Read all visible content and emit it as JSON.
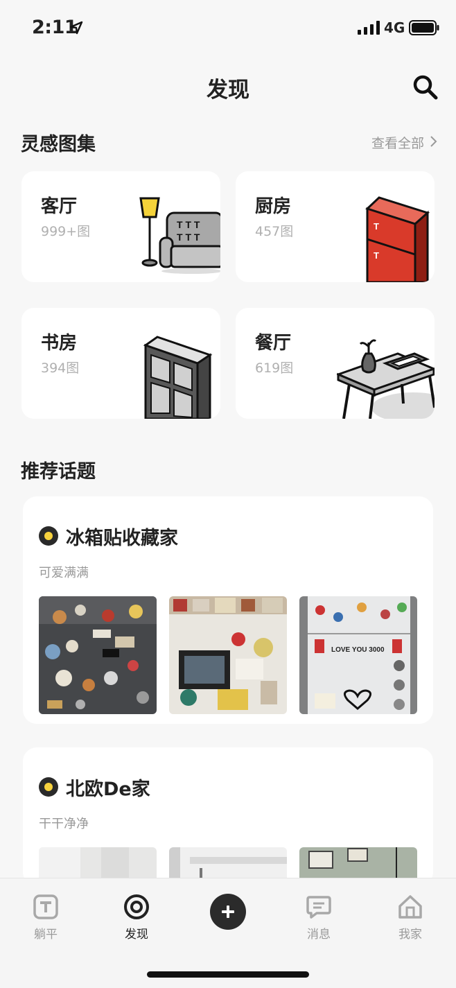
{
  "status": {
    "time": "2:11",
    "network": "4G"
  },
  "header": {
    "title": "发现"
  },
  "inspiration": {
    "title": "灵感图集",
    "see_all": "查看全部",
    "categories": [
      {
        "name": "客厅",
        "count": "999+图",
        "icon": "sofa-lamp-illustration"
      },
      {
        "name": "厨房",
        "count": "457图",
        "icon": "fridge-illustration"
      },
      {
        "name": "书房",
        "count": "394图",
        "icon": "bookshelf-illustration"
      },
      {
        "name": "餐厅",
        "count": "619图",
        "icon": "dining-table-illustration"
      }
    ]
  },
  "topics": {
    "title": "推荐话题",
    "items": [
      {
        "title": "冰箱贴收藏家",
        "subtitle": "可爱满满",
        "thumb_text": "LOVE YOU 3000"
      },
      {
        "title": "北欧De家",
        "subtitle": "干干净净"
      }
    ]
  },
  "tabbar": {
    "items": [
      {
        "label": "躺平",
        "icon": "t-square-icon"
      },
      {
        "label": "发现",
        "icon": "target-icon",
        "active": true
      },
      {
        "label": "",
        "icon": "plus-icon"
      },
      {
        "label": "消息",
        "icon": "message-icon"
      },
      {
        "label": "我家",
        "icon": "home-icon"
      }
    ]
  },
  "colors": {
    "accent_yellow": "#f7d23e",
    "fridge_red": "#d93a2a",
    "dark": "#2b2b2b"
  }
}
